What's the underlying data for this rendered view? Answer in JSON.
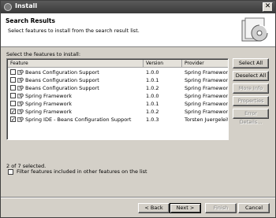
{
  "window": {
    "title": "Install"
  },
  "banner": {
    "heading": "Search Results",
    "subtitle": "Select features to install from the search result list."
  },
  "prompt": "Select the features to install:",
  "table": {
    "columns": [
      "Feature",
      "Version",
      "Provider"
    ],
    "rows": [
      {
        "checked": false,
        "feature": "Beans Configuration Support",
        "version": "1.0.0",
        "provider": "Spring Framework ..."
      },
      {
        "checked": false,
        "feature": "Beans Configuration Support",
        "version": "1.0.1",
        "provider": "Spring Framework ..."
      },
      {
        "checked": false,
        "feature": "Beans Configuration Support",
        "version": "1.0.2",
        "provider": "Spring Framework ..."
      },
      {
        "checked": false,
        "feature": "Spring Framework",
        "version": "1.0.0",
        "provider": "Spring Framework ..."
      },
      {
        "checked": false,
        "feature": "Spring Framework",
        "version": "1.0.1",
        "provider": "Spring Framework ..."
      },
      {
        "checked": true,
        "feature": "Spring Framework",
        "version": "1.0.2",
        "provider": "Spring Framework ..."
      },
      {
        "checked": true,
        "feature": "Spring IDE - Beans Configuration Support",
        "version": "1.0.3",
        "provider": "Torsten Juergeleit"
      }
    ]
  },
  "side_buttons": {
    "select_all": "Select All",
    "deselect_all": "Deselect All",
    "more_info": "More Info",
    "properties": "Properties",
    "error_details": "Error Details..."
  },
  "status": "2 of 7 selected.",
  "filter": {
    "label": "Filter features included in other features on the list",
    "checked": false
  },
  "buttons": {
    "back": "< Back",
    "next": "Next >",
    "finish": "Finish",
    "cancel": "Cancel"
  }
}
